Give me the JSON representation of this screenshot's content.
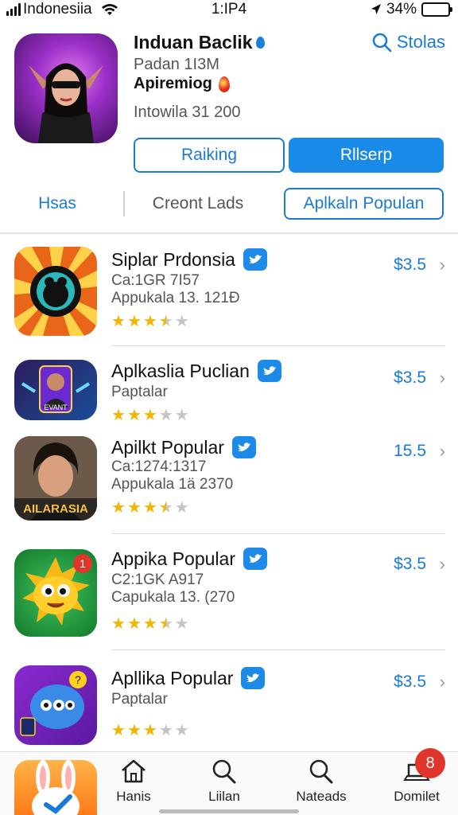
{
  "status_bar": {
    "carrier": "Indonesiia",
    "time": "1:IP4",
    "battery": "34%",
    "battery_level": 0.34
  },
  "hero": {
    "title": "Induan Baclik",
    "subtitle": "Padan 1I3M",
    "developer": "Apiremiog",
    "info": "Intowila 31 200",
    "search_label": "Stolas",
    "btn_ranking": "Raiking",
    "btn_primary": "Rllserp"
  },
  "tabs": [
    {
      "label": "Hsas"
    },
    {
      "label": "Creont Lads"
    },
    {
      "label": "Aplkaln Populan"
    }
  ],
  "apps": [
    {
      "name": "Siplar Prdonsia",
      "line1": "Ca:1GR 7I57",
      "line2": "Appukala 13. 121Đ",
      "rating": 3.5,
      "price": "$3.5"
    },
    {
      "name": "Aplkaslia Puclian",
      "line1": "Paptalar",
      "line2": "",
      "rating": 3,
      "price": "$3.5",
      "icon_text": "EVANT"
    },
    {
      "name": "Apilkt Popular",
      "line1": "Ca:1274:1317",
      "line2": "Appukala 1ä 2370",
      "rating": 3.5,
      "price": "15.5",
      "icon_text": "AILARASIA"
    },
    {
      "name": "Appika Popular",
      "line1": "C2:1GK A917",
      "line2": "Capukala 13. (270",
      "rating": 3.5,
      "price": "$3.5",
      "icon_badge": "1"
    },
    {
      "name": "Apllika Popular",
      "line1": "Paptalar",
      "line2": "",
      "rating": 3,
      "price": "$3.5"
    }
  ],
  "tabbar": {
    "items": [
      {
        "label": "Hanis",
        "icon": "home-icon"
      },
      {
        "label": "Liilan",
        "icon": "search-icon"
      },
      {
        "label": "Nateads",
        "icon": "search-icon"
      },
      {
        "label": "Domilet",
        "icon": "laptop-icon"
      }
    ],
    "badge": "8"
  },
  "colors": {
    "accent": "#1a7ad8",
    "badge_red": "#e0352b",
    "star": "#f5b400"
  }
}
